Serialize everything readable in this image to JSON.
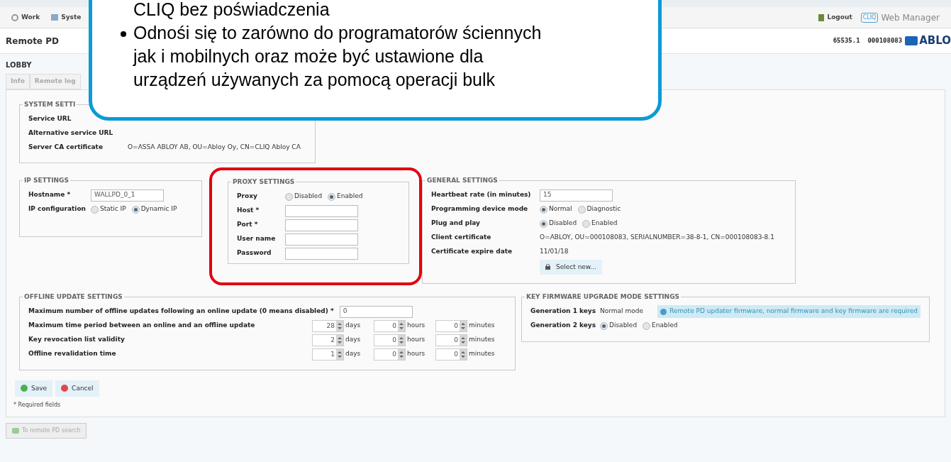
{
  "nav": [
    {
      "label": "Work",
      "kind": "gear"
    },
    {
      "label": "Syste",
      "kind": "window"
    }
  ],
  "header_right": {
    "logout": "Logout",
    "web_manager": "Web Manager",
    "badge": "CLIQ"
  },
  "page_title": "Remote PD",
  "device_id": "65535.1  000108083",
  "logo": "ABLO",
  "lock_name": "LOBBY",
  "tabs": [
    {
      "label": "Info",
      "selected": false
    },
    {
      "label": "Remote log",
      "selected": false
    }
  ],
  "system_settings": {
    "title": "SYSTEM SETTI",
    "rows": [
      {
        "kind": "text",
        "label": "Service URL"
      },
      {
        "kind": "text",
        "label": "Alternative service URL"
      },
      {
        "kind": "text",
        "label": "Server CA certificate",
        "value": "O=ASSA ABLOY AB, OU=Abloy Oy, CN=CLIQ Abloy CA"
      }
    ]
  },
  "ip_settings": {
    "title": "IP SETTINGS",
    "rows": [
      {
        "kind": "input",
        "label": "Hostname *",
        "value": "WALLPD_0_1"
      },
      {
        "kind": "radio",
        "label": "IP configuration",
        "options": [
          {
            "label": "Static IP",
            "selected": false
          },
          {
            "label": "Dynamic IP",
            "selected": true
          }
        ]
      }
    ]
  },
  "proxy_settings": {
    "title": "PROXY SETTINGS",
    "highlighted": true,
    "rows": [
      {
        "kind": "radio",
        "label": "Proxy",
        "options": [
          {
            "label": "Disabled",
            "selected": false
          },
          {
            "label": "Enabled",
            "selected": true
          }
        ]
      },
      {
        "kind": "input",
        "label": "Host *"
      },
      {
        "kind": "input",
        "label": "Port *"
      },
      {
        "kind": "input",
        "label": "User name"
      },
      {
        "kind": "input",
        "label": "Password"
      }
    ]
  },
  "general_settings": {
    "title": "GENERAL SETTINGS",
    "rows": [
      {
        "kind": "input",
        "label": "Heartbeat rate (in minutes)",
        "value": "15"
      },
      {
        "kind": "radio",
        "label": "Programming device mode",
        "options": [
          {
            "label": "Normal",
            "selected": true
          },
          {
            "label": "Diagnostic",
            "selected": false
          }
        ]
      },
      {
        "kind": "radio",
        "label": "Plug and play",
        "options": [
          {
            "label": "Disabled",
            "selected": true
          },
          {
            "label": "Enabled",
            "selected": false
          }
        ]
      },
      {
        "kind": "text",
        "label": "Client certificate",
        "value": "O=ABLOY, OU=000108083, SERIALNUMBER=38-8-1, CN=000108083-8.1"
      },
      {
        "kind": "text",
        "label": "Certificate expire date",
        "value": "11/01/18"
      },
      {
        "kind": "button",
        "value": "Select new..."
      }
    ]
  },
  "offline_update_settings": {
    "title": "OFFLINE UPDATE SETTINGS",
    "rows": [
      {
        "kind": "input",
        "label": "Maximum number of offline updates following an online update (0 means disabled) *",
        "value": "0"
      },
      {
        "kind": "spinners",
        "label": "Maximum time period between an online and an offline update",
        "fields": [
          {
            "value": "28",
            "unit": "days"
          },
          {
            "value": "0",
            "unit": "hours"
          },
          {
            "value": "0",
            "unit": "minutes"
          }
        ]
      },
      {
        "kind": "spinners",
        "label": "Key revocation list validity",
        "fields": [
          {
            "value": "2",
            "unit": "days"
          },
          {
            "value": "0",
            "unit": "hours"
          },
          {
            "value": "0",
            "unit": "minutes"
          }
        ]
      },
      {
        "kind": "spinners",
        "label": "Offline revalidation time",
        "fields": [
          {
            "value": "1",
            "unit": "days"
          },
          {
            "value": "0",
            "unit": "hours"
          },
          {
            "value": "0",
            "unit": "minutes"
          }
        ]
      }
    ]
  },
  "key_firmware_settings": {
    "title": "KEY FIRMWARE UPGRADE MODE SETTINGS",
    "rows": [
      {
        "kind": "text",
        "label": "Generation 1 keys",
        "value": "Normal mode",
        "note": "Remote PD updater firmware, normal firmware and key firmware are required"
      },
      {
        "kind": "radio",
        "label": "Generation 2 keys",
        "options": [
          {
            "label": "Disabled",
            "selected": true
          },
          {
            "label": "Enabled",
            "selected": false
          }
        ]
      }
    ]
  },
  "actions": [
    {
      "label": "Save",
      "kind": "ok"
    },
    {
      "label": "Cancel",
      "kind": "cancel"
    }
  ],
  "required_note": "* Required fields",
  "back_button": "To remote PD search",
  "callout": {
    "lines": [
      {
        "text": "CLIQ bez poświadczenia",
        "kind": "continuation"
      },
      {
        "text": "Odnośi się to zarówno do programatorów ściennych jak i mobilnych oraz może być ustawione dla urządzeń używanych za pomocą operacji bulk",
        "kind": "bullet"
      }
    ]
  }
}
